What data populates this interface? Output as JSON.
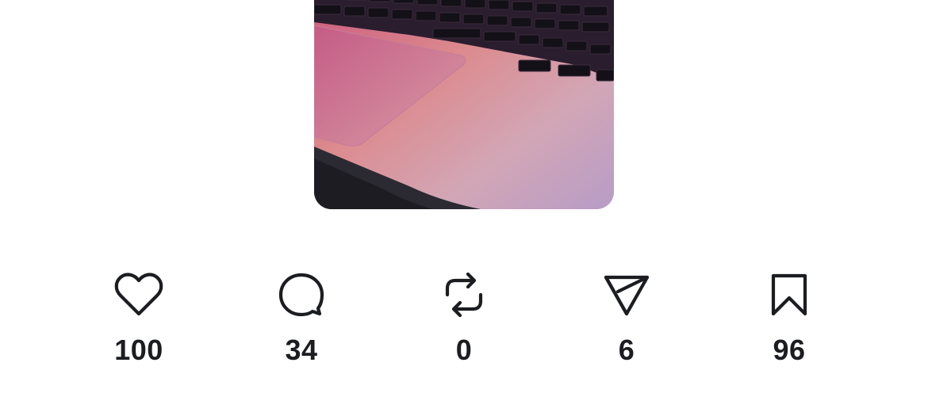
{
  "post": {
    "image_icon": "laptop-keyboard-photo"
  },
  "actions": [
    {
      "name": "like",
      "icon": "heart-icon",
      "count": "100"
    },
    {
      "name": "comment",
      "icon": "comment-icon",
      "count": "34"
    },
    {
      "name": "repost",
      "icon": "repost-icon",
      "count": "0"
    },
    {
      "name": "share",
      "icon": "send-icon",
      "count": "6"
    },
    {
      "name": "bookmark",
      "icon": "bookmark-icon",
      "count": "96"
    }
  ],
  "colors": {
    "icon_stroke": "#1b1d21",
    "count_text": "#1b1d21",
    "background": "#ffffff"
  }
}
